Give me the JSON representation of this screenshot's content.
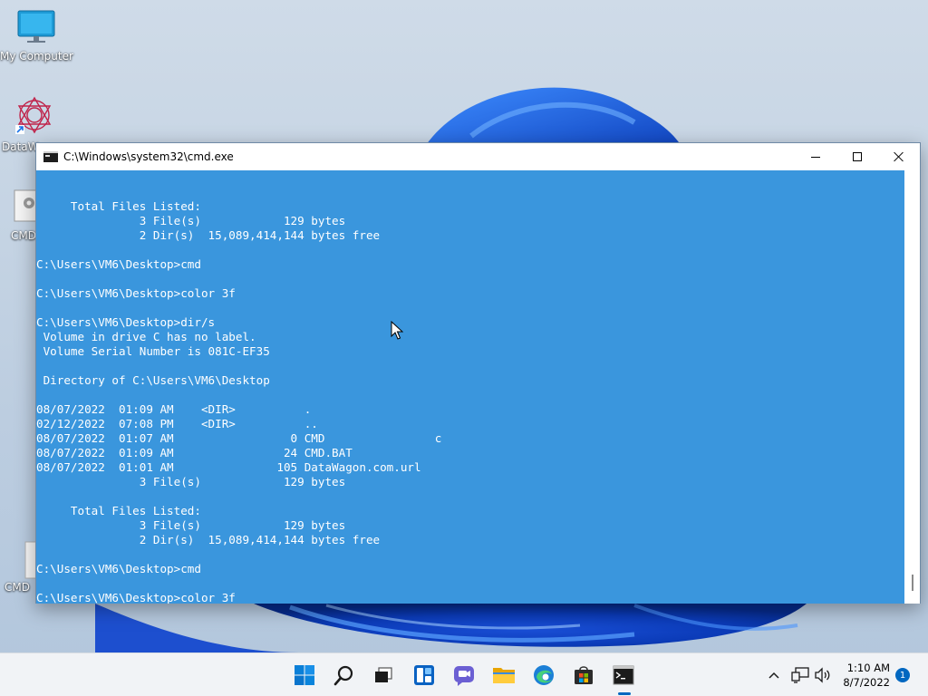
{
  "desktop": {
    "icons": [
      {
        "label": "My Computer"
      },
      {
        "label": "DataW"
      },
      {
        "label": "CMD"
      },
      {
        "label": "CMD"
      }
    ]
  },
  "window": {
    "title": "C:\\Windows\\system32\\cmd.exe",
    "console_lines": [
      "",
      "     Total Files Listed:",
      "               3 File(s)            129 bytes",
      "               2 Dir(s)  15,089,414,144 bytes free",
      "",
      "C:\\Users\\VM6\\Desktop>cmd",
      "",
      "C:\\Users\\VM6\\Desktop>color 3f",
      "",
      "C:\\Users\\VM6\\Desktop>dir/s",
      " Volume in drive C has no label.",
      " Volume Serial Number is 081C-EF35",
      "",
      " Directory of C:\\Users\\VM6\\Desktop",
      "",
      "08/07/2022  01:09 AM    <DIR>          .",
      "02/12/2022  07:08 PM    <DIR>          ..",
      "08/07/2022  01:07 AM                 0 CMD                c",
      "08/07/2022  01:09 AM                24 CMD.BAT",
      "08/07/2022  01:01 AM               105 DataWagon.com.url",
      "               3 File(s)            129 bytes",
      "",
      "     Total Files Listed:",
      "               3 File(s)            129 bytes",
      "               2 Dir(s)  15,089,414,144 bytes free",
      "",
      "C:\\Users\\VM6\\Desktop>cmd",
      "",
      "C:\\Users\\VM6\\Desktop>color 3f"
    ]
  },
  "taskbar": {
    "icons": [
      "start-icon",
      "search-icon",
      "task-view-icon",
      "widgets-icon",
      "chat-icon",
      "file-explorer-icon",
      "edge-icon",
      "store-icon",
      "cmd-icon"
    ],
    "clock_time": "1:10 AM",
    "clock_date": "8/7/2022",
    "notification_count": "1"
  },
  "colors": {
    "console_bg": "#3a96dd",
    "console_fg": "#ffffff",
    "accent": "#0067c0"
  }
}
